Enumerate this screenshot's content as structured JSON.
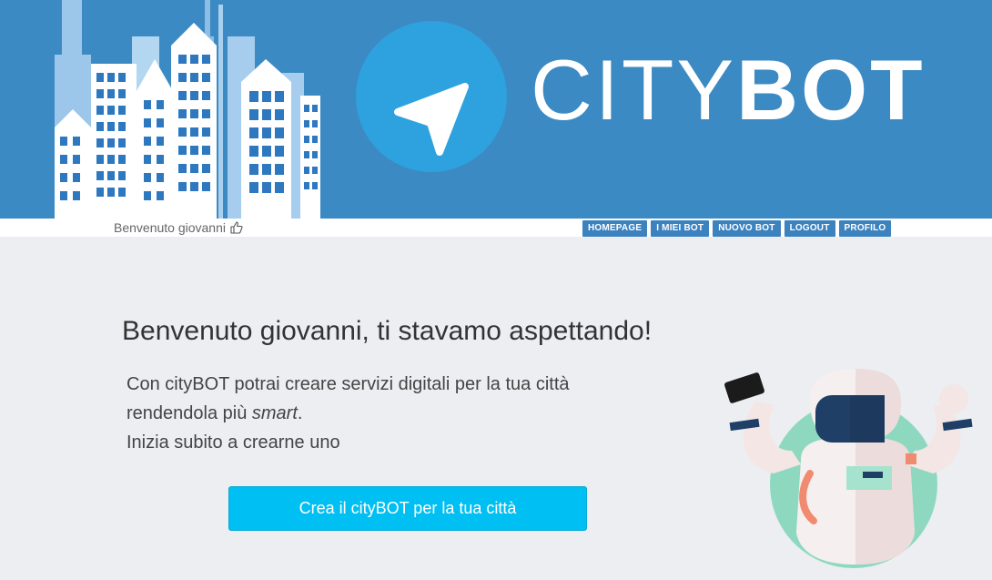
{
  "header": {
    "brand_light": "CITY",
    "brand_bold": "BOT",
    "colors": {
      "banner": "#3c8ac3",
      "logo_circle": "#2ea2de",
      "cta": "#00bff2",
      "nav": "#3c82bf"
    }
  },
  "user_bar": {
    "welcome": "Benvenuto giovanni",
    "icon": "thumbs-up-icon"
  },
  "nav": {
    "items": [
      "HOMEPAGE",
      "I MIEI BOT",
      "NUOVO BOT",
      "LOGOUT",
      "PROFILO"
    ]
  },
  "main": {
    "headline": "Benvenuto giovanni, ti stavamo aspettando!",
    "line1": "Con cityBOT potrai creare servizi digitali per la tua città",
    "line2_prefix": "rendendola più ",
    "line2_emphasis": "smart",
    "line2_suffix": ".",
    "line3": "Inizia subito a crearne uno",
    "cta_label": "Crea il cityBOT per la tua città"
  }
}
